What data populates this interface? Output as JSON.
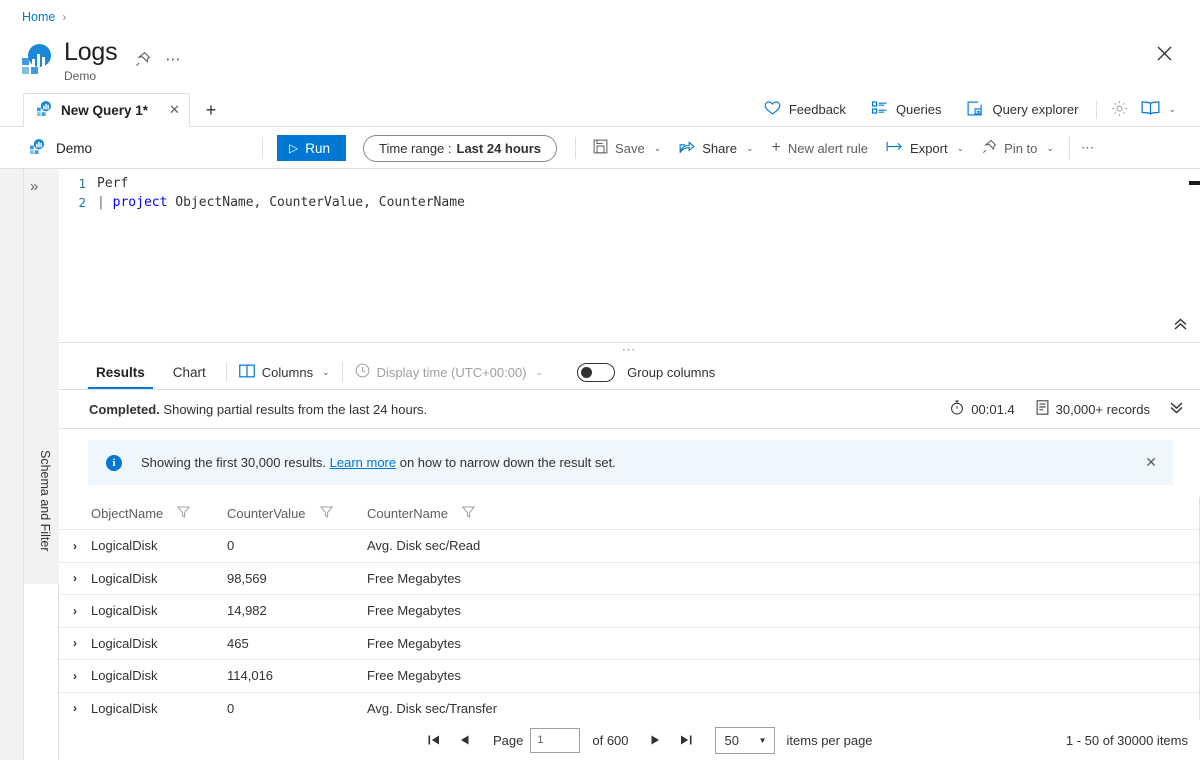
{
  "breadcrumb": {
    "home": "Home",
    "separator": "›"
  },
  "header": {
    "title": "Logs",
    "subtitle": "Demo",
    "pin_icon": "pin-icon",
    "more_icon": "ellipsis-icon",
    "close_icon": "close-icon"
  },
  "tabs": {
    "items": [
      {
        "label": "New Query 1*",
        "close": "✕",
        "icon": "query-icon"
      }
    ],
    "add_label": "+",
    "right_actions": [
      {
        "label": "Feedback",
        "icon": "heart-icon"
      },
      {
        "label": "Queries",
        "icon": "list-icon"
      },
      {
        "label": "Query explorer",
        "icon": "explorer-icon"
      }
    ],
    "settings_icon": "gear-icon",
    "book_icon": "book-icon",
    "book_chevron": "⌄"
  },
  "commandbar": {
    "workspace": "Demo",
    "workspace_icon": "workspace-icon",
    "run_label": "Run",
    "run_icon": "▷",
    "time_range_label": "Time range :",
    "time_range_value": "Last 24 hours",
    "actions": [
      {
        "label": "Save",
        "icon": "save-icon",
        "chevron": "⌄"
      },
      {
        "label": "Share",
        "icon": "share-icon",
        "chevron": "⌄"
      },
      {
        "label": "New alert rule",
        "icon": "plus-icon",
        "chevron": ""
      },
      {
        "label": "Export",
        "icon": "export-icon",
        "chevron": "⌄"
      },
      {
        "label": "Pin to",
        "icon": "pin-icon",
        "chevron": "⌄"
      }
    ],
    "more_label": "⋯"
  },
  "sidebar": {
    "expand_icon": "»",
    "label": "Schema and Filter"
  },
  "editor": {
    "lines": [
      {
        "number": "1",
        "segments": [
          {
            "text": "Perf",
            "style": "plain"
          }
        ]
      },
      {
        "number": "2",
        "segments": [
          {
            "text": "| ",
            "style": "pipe"
          },
          {
            "text": "project",
            "style": "keyword"
          },
          {
            "text": " ObjectName, CounterValue, CounterName",
            "style": "plain"
          }
        ]
      }
    ],
    "collapse_icon": "«",
    "splitter_dots": "⋯"
  },
  "results": {
    "tabs": [
      {
        "label": "Results",
        "active": true
      },
      {
        "label": "Chart",
        "active": false
      }
    ],
    "columns_label": "Columns",
    "columns_icon": "columns-icon",
    "columns_chevron": "⌄",
    "display_time_label": "Display time (UTC+00:00)",
    "display_time_icon": "clock-icon",
    "display_time_chevron": "⌄",
    "group_columns_label": "Group columns",
    "group_columns_on": false
  },
  "status": {
    "state": "Completed.",
    "message": "Showing partial results from the last 24 hours.",
    "duration": "00:01.4",
    "duration_icon": "timer-icon",
    "records": "30,000+ records",
    "records_icon": "records-icon",
    "collapse_icon": "ˇˇ"
  },
  "banner": {
    "icon": "info-icon",
    "text_before": "Showing the first 30,000 results.",
    "link": "Learn more",
    "text_after": "on how to narrow down the result set.",
    "close": "✕"
  },
  "table": {
    "columns": [
      {
        "label": "ObjectName",
        "filter_icon": "filter-icon"
      },
      {
        "label": "CounterValue",
        "filter_icon": "filter-icon"
      },
      {
        "label": "CounterName",
        "filter_icon": "filter-icon"
      }
    ],
    "expand_icon": "›",
    "rows": [
      {
        "ObjectName": "LogicalDisk",
        "CounterValue": "0",
        "CounterName": "Avg. Disk sec/Read"
      },
      {
        "ObjectName": "LogicalDisk",
        "CounterValue": "98,569",
        "CounterName": "Free Megabytes"
      },
      {
        "ObjectName": "LogicalDisk",
        "CounterValue": "14,982",
        "CounterName": "Free Megabytes"
      },
      {
        "ObjectName": "LogicalDisk",
        "CounterValue": "465",
        "CounterName": "Free Megabytes"
      },
      {
        "ObjectName": "LogicalDisk",
        "CounterValue": "114,016",
        "CounterName": "Free Megabytes"
      },
      {
        "ObjectName": "LogicalDisk",
        "CounterValue": "0",
        "CounterName": "Avg. Disk sec/Transfer"
      }
    ]
  },
  "pager": {
    "first_icon": "⏮",
    "prev_icon": "◀",
    "page_label": "Page",
    "page_value": "1",
    "of_label": "of 600",
    "next_icon": "▶",
    "last_icon": "⏭",
    "page_size": "50",
    "page_size_chevron": "▼",
    "items_per_page_label": "items per page",
    "range_label": "1 - 50 of 30000 items"
  },
  "colors": {
    "accent": "#0078d4",
    "link": "#0078d4",
    "banner_bg": "#eff6fc",
    "border": "#e1dfdd",
    "text": "#323130"
  }
}
